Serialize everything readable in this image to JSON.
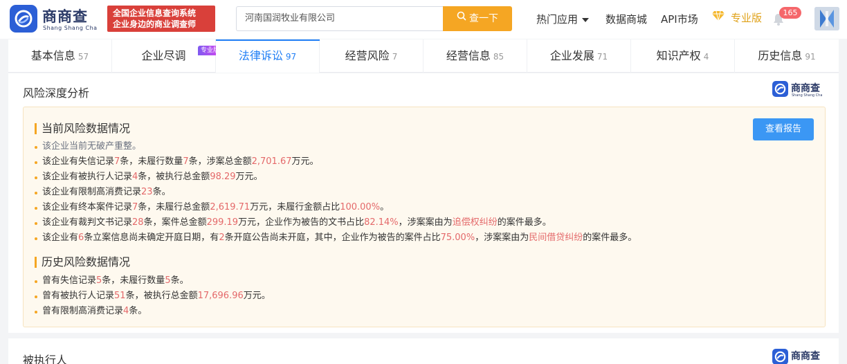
{
  "header": {
    "logo_cn": "商商查",
    "logo_pinyin": "Shang Shang Cha",
    "slogan_line1": "全国企业信息查询系统",
    "slogan_line2": "企业身边的商业调查师",
    "search_value": "河南国润牧业有限公司",
    "search_button": "查一下",
    "nav_hot_apps": "热门应用",
    "nav_data_mall": "数据商城",
    "nav_api_market": "API市场",
    "pro_label": "专业版",
    "notification_count": "165",
    "icons": {
      "logo": "logo-icon",
      "search": "search-icon",
      "dropdown": "chevron-down-icon",
      "pro": "diamond-icon",
      "bell": "bell-icon",
      "avatar": "avatar"
    },
    "colors": {
      "brand_blue": "#2c5fd6",
      "slogan_red": "#d9403a",
      "search_orange": "#f5a623",
      "pro_gold": "#e0a21a"
    }
  },
  "tabs": [
    {
      "label": "基本信息",
      "count": "57"
    },
    {
      "label": "企业尽调",
      "count": "",
      "tag": "专业版"
    },
    {
      "label": "法律诉讼",
      "count": "97",
      "active": true
    },
    {
      "label": "经营风险",
      "count": "7"
    },
    {
      "label": "经营信息",
      "count": "85"
    },
    {
      "label": "企业发展",
      "count": "71"
    },
    {
      "label": "知识产权",
      "count": "4"
    },
    {
      "label": "历史信息",
      "count": "91"
    }
  ],
  "risk_analysis": {
    "title": "风险深度分析",
    "report_button": "查看报告",
    "current": {
      "title": "当前风险数据情况",
      "items": [
        {
          "parts": [
            {
              "t": "该企业当前无破产重整。"
            }
          ],
          "muted": true
        },
        {
          "parts": [
            {
              "t": "该企业有失信记录"
            },
            {
              "t": "7",
              "h": true
            },
            {
              "t": "条，未履行数量"
            },
            {
              "t": "7",
              "h": true
            },
            {
              "t": "条，涉案总金额"
            },
            {
              "t": "2,701.67",
              "h": true
            },
            {
              "t": "万元。"
            }
          ]
        },
        {
          "parts": [
            {
              "t": "该企业有被执行人记录"
            },
            {
              "t": "4",
              "h": true
            },
            {
              "t": "条，被执行总金额"
            },
            {
              "t": "98.29",
              "h": true
            },
            {
              "t": "万元。"
            }
          ]
        },
        {
          "parts": [
            {
              "t": "该企业有限制高消费记录"
            },
            {
              "t": "23",
              "h": true
            },
            {
              "t": "条。"
            }
          ]
        },
        {
          "parts": [
            {
              "t": "该企业有终本案件记录"
            },
            {
              "t": "7",
              "h": true
            },
            {
              "t": "条，未履行总金额"
            },
            {
              "t": "2,619.71",
              "h": true
            },
            {
              "t": "万元，未履行金额占比"
            },
            {
              "t": "100.00%",
              "h": true
            },
            {
              "t": "。"
            }
          ]
        },
        {
          "parts": [
            {
              "t": "该企业有裁判文书记录"
            },
            {
              "t": "28",
              "h": true
            },
            {
              "t": "条，案件总金额"
            },
            {
              "t": "299.19",
              "h": true
            },
            {
              "t": "万元，企业作为被告的文书占比"
            },
            {
              "t": "82.14%",
              "h": true
            },
            {
              "t": "，涉案案由为"
            },
            {
              "t": "追偿权纠纷",
              "h": true
            },
            {
              "t": "的案件最多。"
            }
          ]
        },
        {
          "parts": [
            {
              "t": "该企业有"
            },
            {
              "t": "6",
              "h": true
            },
            {
              "t": "条立案信息尚未确定开庭日期，有"
            },
            {
              "t": "2",
              "h": true
            },
            {
              "t": "条开庭公告尚未开庭，其中，企业作为被告的案件占比"
            },
            {
              "t": "75.00%",
              "h": true
            },
            {
              "t": "，涉案案由为"
            },
            {
              "t": "民间借贷纠纷",
              "h": true
            },
            {
              "t": "的案件最多。"
            }
          ]
        }
      ]
    },
    "history": {
      "title": "历史风险数据情况",
      "items": [
        {
          "parts": [
            {
              "t": "曾有失信记录"
            },
            {
              "t": "5",
              "h": true
            },
            {
              "t": "条，未履行数量"
            },
            {
              "t": "5",
              "h": true
            },
            {
              "t": "条。"
            }
          ]
        },
        {
          "parts": [
            {
              "t": "曾有被执行人记录"
            },
            {
              "t": "51",
              "h": true
            },
            {
              "t": "条，被执行总金额"
            },
            {
              "t": "17,696.96",
              "h": true
            },
            {
              "t": "万元。"
            }
          ]
        },
        {
          "parts": [
            {
              "t": "曾有限制高消费记录"
            },
            {
              "t": "4",
              "h": true
            },
            {
              "t": "条。"
            }
          ]
        }
      ]
    },
    "colors": {
      "highlight": "#e4696a",
      "box_bg": "#fef9ef",
      "active_tab": "#1f7ef5"
    }
  },
  "executed_section": {
    "title": "被执行人"
  }
}
